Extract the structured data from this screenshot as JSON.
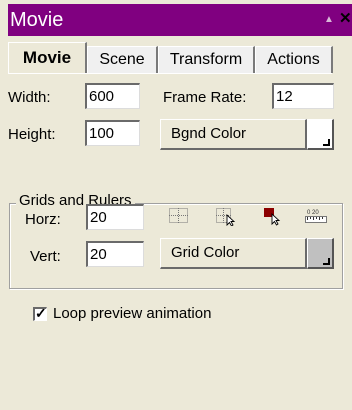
{
  "window": {
    "title": "Movie",
    "scroll_arrow": "▲",
    "close": "✕"
  },
  "tabs": [
    {
      "label": "Movie",
      "active": true
    },
    {
      "label": "Scene",
      "active": false
    },
    {
      "label": "Transform",
      "active": false
    },
    {
      "label": "Actions",
      "active": false
    }
  ],
  "movie": {
    "width_label": "Width:",
    "width_value": "600",
    "frame_rate_label": "Frame Rate:",
    "frame_rate_value": "12",
    "height_label": "Height:",
    "height_value": "100",
    "bgnd_color_label": "Bgnd Color",
    "bgnd_color": "#ffffff"
  },
  "grids": {
    "legend": "Grids and Rulers",
    "horz_label": "Horz:",
    "horz_value": "20",
    "vert_label": "Vert:",
    "vert_value": "20",
    "grid_color_label": "Grid Color",
    "grid_color": "#c0c0c0",
    "icons": [
      "show-grid-icon",
      "snap-to-grid-icon",
      "snap-to-object-icon",
      "ruler-icon"
    ],
    "ruler_text": "0 20"
  },
  "loop": {
    "label": "Loop preview animation",
    "checked": true
  }
}
